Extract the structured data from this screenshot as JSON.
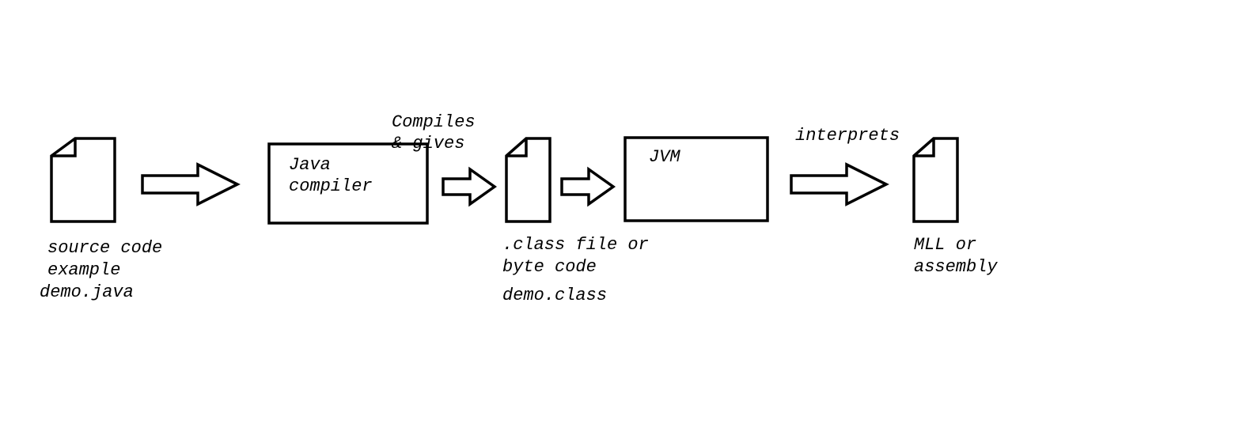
{
  "nodes": {
    "source": {
      "caption1": "source code",
      "caption2": "example",
      "caption3": "demo.java"
    },
    "compiler": {
      "label1": "Java",
      "label2": "compiler"
    },
    "arrow2_label1": "Compiles",
    "arrow2_label2": "& gives",
    "classfile": {
      "caption1": ".class file or",
      "caption2": "byte code",
      "caption3": "demo.class"
    },
    "jvm": {
      "label": "JVM"
    },
    "arrow4_label": "interprets",
    "output": {
      "caption1": "MLL or",
      "caption2": "assembly"
    }
  }
}
